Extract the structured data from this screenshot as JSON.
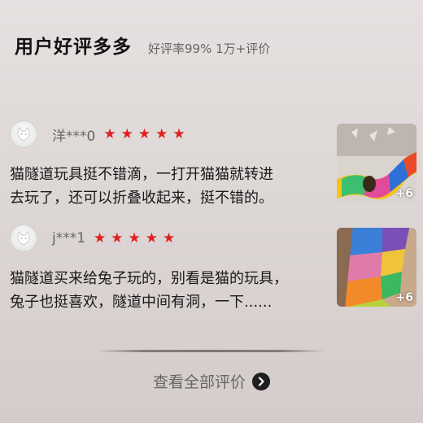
{
  "header": {
    "title": "用户好评多多",
    "subtitle": "好评率99% 1万+评价"
  },
  "reviews": [
    {
      "username": "洋***0",
      "rating": 5,
      "stars": [
        "★",
        "★",
        "★",
        "★",
        "★"
      ],
      "text_line1": "猫隧道玩具挺不错滴，一打开猫猫就转进",
      "text_line2": "去玩了，还可以折叠收起来，挺不错的。",
      "photo_count": "+6"
    },
    {
      "username": "j***1",
      "rating": 5,
      "stars": [
        "★",
        "★",
        "★",
        "★",
        "★"
      ],
      "text_line1": "猫隧道买来给兔子玩的，别看是猫的玩具，",
      "text_line2": "兔子也挺喜欢，隧道中间有洞，一下......",
      "photo_count": "+6"
    }
  ],
  "footer": {
    "view_all_label": "查看全部评价"
  },
  "colors": {
    "star": "#e02020",
    "background": "#ddd7d6",
    "arrow_button": "#1e1e1e"
  },
  "icons": {
    "avatar": "default-avatar-icon",
    "star": "star-icon",
    "arrow": "chevron-right-icon"
  }
}
